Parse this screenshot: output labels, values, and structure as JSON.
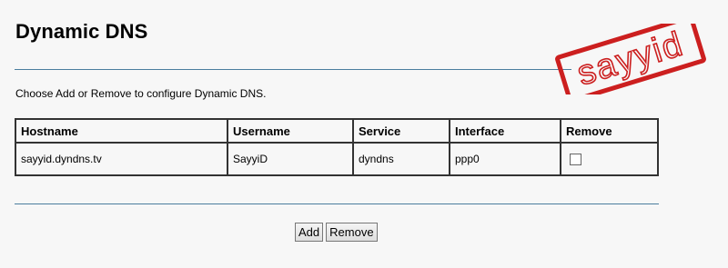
{
  "page": {
    "title": "Dynamic DNS",
    "instructions": "Choose Add or Remove to configure Dynamic DNS."
  },
  "table": {
    "headers": [
      "Hostname",
      "Username",
      "Service",
      "Interface",
      "Remove"
    ],
    "rows": [
      {
        "hostname": "sayyid.dyndns.tv",
        "username": "SayyiD",
        "service": "dyndns",
        "interface": "ppp0",
        "remove_checked": false
      }
    ]
  },
  "buttons": {
    "add": "Add",
    "remove": "Remove"
  },
  "watermark": {
    "text": "sayyid",
    "color": "#cc1f1f"
  }
}
